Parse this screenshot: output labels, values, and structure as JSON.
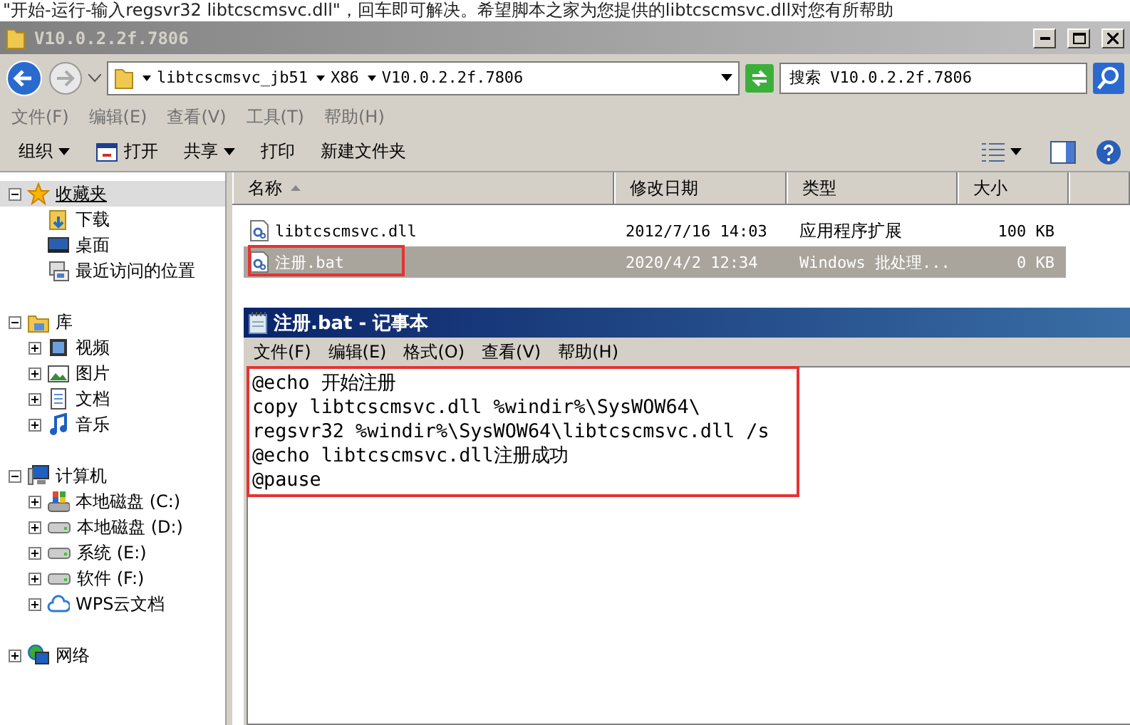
{
  "page_banner": "\"开始-运行-输入regsvr32 libtcscmsvc.dll\"，回车即可解决。希望脚本之家为您提供的libtcscmsvc.dll对您有所帮助",
  "explorer": {
    "title": "V10.0.2.2f.7806",
    "breadcrumb": [
      "libtcscmsvc_jb51",
      "X86",
      "V10.0.2.2f.7806"
    ],
    "search": {
      "placeholder": "搜索 V10.0.2.2f.7806"
    },
    "menu": [
      "文件(F)",
      "编辑(E)",
      "查看(V)",
      "工具(T)",
      "帮助(H)"
    ],
    "toolbar": [
      {
        "label": "组织",
        "kind": "dropdown"
      },
      {
        "label": "打开",
        "kind": "icon"
      },
      {
        "label": "共享",
        "kind": "dropdown"
      },
      {
        "label": "打印",
        "kind": "plain"
      },
      {
        "label": "新建文件夹",
        "kind": "plain"
      }
    ],
    "nav": [
      {
        "label": "收藏夹",
        "kind": "star",
        "expanded": true,
        "selected": true,
        "children": [
          {
            "label": "下载",
            "kind": "download",
            "selected": false
          },
          {
            "label": "桌面",
            "kind": "desktop",
            "selected": false
          },
          {
            "label": "最近访问的位置",
            "kind": "recent",
            "selected": false
          }
        ]
      },
      {
        "label": "库",
        "kind": "library",
        "expanded": true,
        "selected": false,
        "children": [
          {
            "label": "视频",
            "kind": "video",
            "expanded": false,
            "selected": false
          },
          {
            "label": "图片",
            "kind": "picture",
            "expanded": false,
            "selected": false
          },
          {
            "label": "文档",
            "kind": "document",
            "expanded": false,
            "selected": false
          },
          {
            "label": "音乐",
            "kind": "music",
            "expanded": false,
            "selected": false
          }
        ]
      },
      {
        "label": "计算机",
        "kind": "computer",
        "expanded": true,
        "selected": false,
        "children": [
          {
            "label": "本地磁盘 (C:)",
            "kind": "system-drive",
            "expanded": false,
            "selected": false
          },
          {
            "label": "本地磁盘 (D:)",
            "kind": "drive",
            "expanded": false,
            "selected": false
          },
          {
            "label": "系统 (E:)",
            "kind": "drive",
            "expanded": false,
            "selected": false
          },
          {
            "label": "软件 (F:)",
            "kind": "drive",
            "expanded": false,
            "selected": false
          },
          {
            "label": "WPS云文档",
            "kind": "cloud",
            "expanded": false,
            "selected": false
          }
        ]
      },
      {
        "label": "网络",
        "kind": "network",
        "expanded": false,
        "selected": false
      }
    ],
    "columns": [
      {
        "label": "名称",
        "sorted": true
      },
      {
        "label": "修改日期",
        "sorted": false
      },
      {
        "label": "类型",
        "sorted": false
      },
      {
        "label": "大小",
        "sorted": false
      }
    ],
    "files": [
      {
        "name": "libtcscmsvc.dll",
        "date": "2012/7/16 14:03",
        "type": "应用程序扩展",
        "size": "100 KB",
        "selected": false,
        "highlighted": false
      },
      {
        "name": "注册.bat",
        "date": "2020/4/2 12:34",
        "type": "Windows 批处理...",
        "size": "0 KB",
        "selected": true,
        "highlighted": true
      }
    ]
  },
  "notepad": {
    "title": "注册.bat - 记事本",
    "menu": [
      "文件(F)",
      "编辑(E)",
      "格式(O)",
      "查看(V)",
      "帮助(H)"
    ],
    "lines": [
      "@echo 开始注册",
      "copy libtcscmsvc.dll %windir%\\SysWOW64\\",
      "regsvr32 %windir%\\SysWOW64\\libtcscmsvc.dll /s",
      "@echo libtcscmsvc.dll注册成功",
      "@pause"
    ],
    "highlighted": true
  }
}
